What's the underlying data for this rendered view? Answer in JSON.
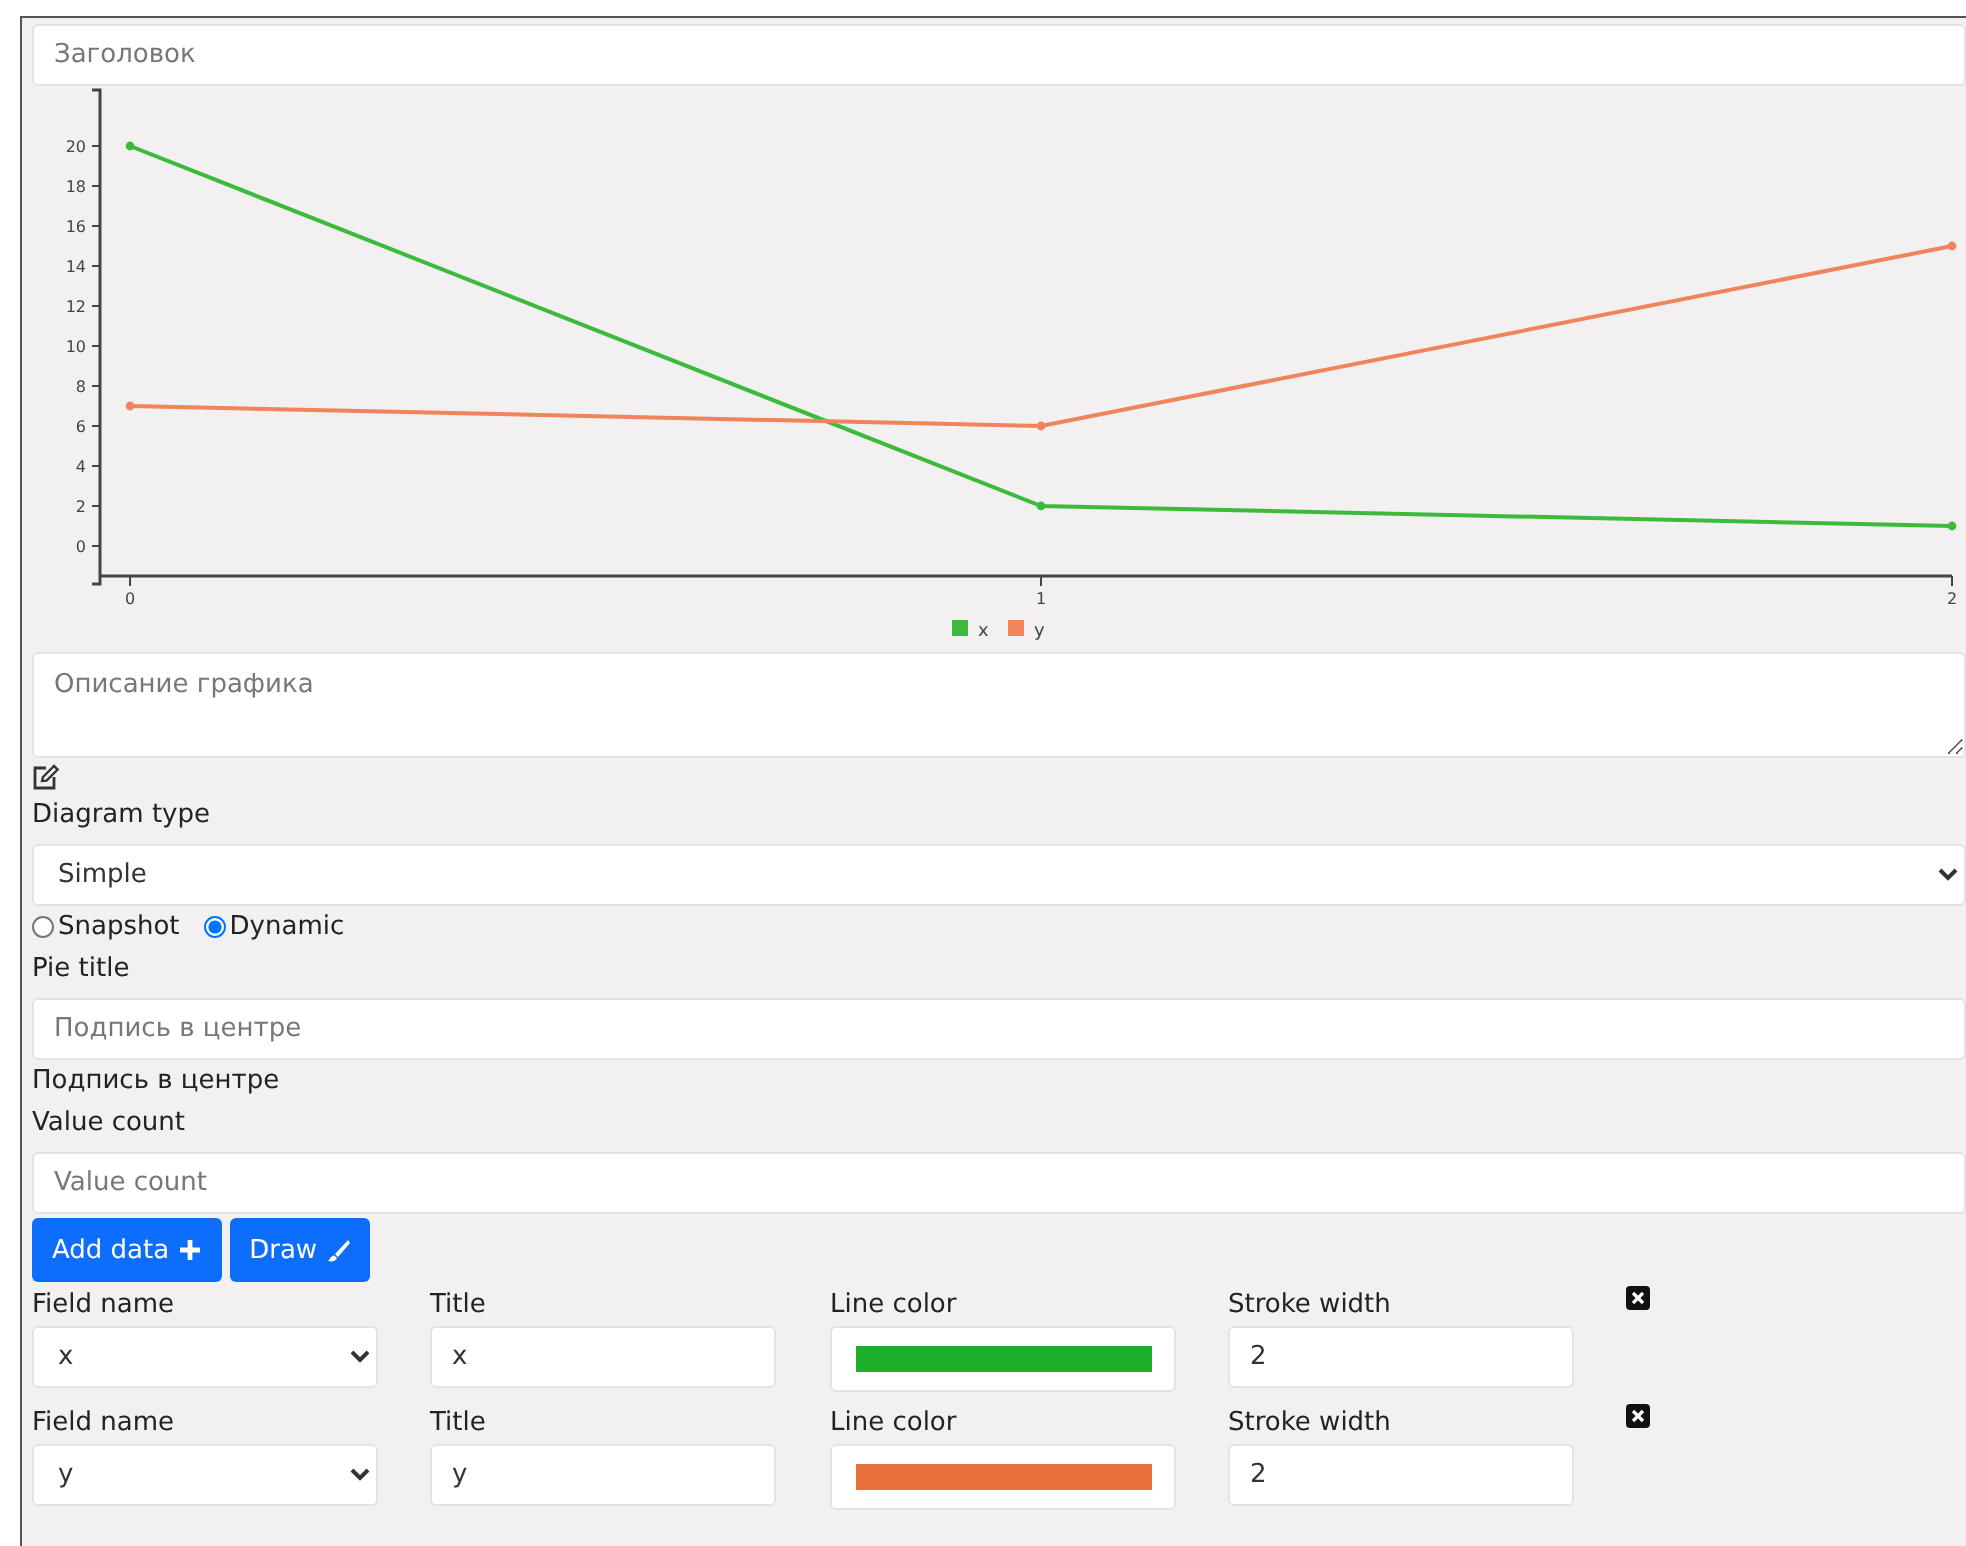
{
  "title_field": {
    "placeholder": "Заголовок"
  },
  "chart": {
    "chart_data": {
      "type": "line",
      "x": [
        0,
        1,
        2
      ],
      "xticks": [
        0,
        1,
        2
      ],
      "xlim": [
        -0.033,
        2
      ],
      "legend": true,
      "yticks": [
        0,
        2,
        4,
        6,
        8,
        10,
        12,
        14,
        16,
        18,
        20
      ],
      "ylim": [
        -1.5,
        22.8
      ],
      "series": [
        {
          "name": "x",
          "color": "#3cba3c",
          "marker": "circle",
          "values": [
            20,
            2,
            1
          ]
        },
        {
          "name": "y",
          "color": "#f0845a",
          "marker": "circle",
          "values": [
            7,
            6,
            15
          ]
        }
      ]
    }
  },
  "description_field": {
    "placeholder": "Описание графика"
  },
  "diagram_type": {
    "label": "Diagram type",
    "value": "Simple"
  },
  "mode_radios": [
    {
      "label": "Snapshot",
      "selected": false
    },
    {
      "label": "Dynamic",
      "selected": true
    }
  ],
  "pie_title": {
    "label": "Pie title",
    "placeholder": "Подпись в центре",
    "caption": "Подпись в центре"
  },
  "value_count": {
    "label": "Value count",
    "placeholder": "Value count"
  },
  "buttons": [
    {
      "label": "Add data",
      "kind": "add"
    },
    {
      "label": "Draw",
      "kind": "draw"
    }
  ],
  "series_rows": [
    {
      "field_label": "Field name",
      "field_value": "x",
      "title_label": "Title",
      "title_value": "x",
      "color_label": "Line color",
      "color": "#1fae2a",
      "stroke_label": "Stroke width",
      "stroke_value": "2"
    },
    {
      "field_label": "Field name",
      "field_value": "y",
      "title_label": "Title",
      "title_value": "y",
      "color_label": "Line color",
      "color": "#e8703a",
      "stroke_label": "Stroke width",
      "stroke_value": "2"
    }
  ]
}
